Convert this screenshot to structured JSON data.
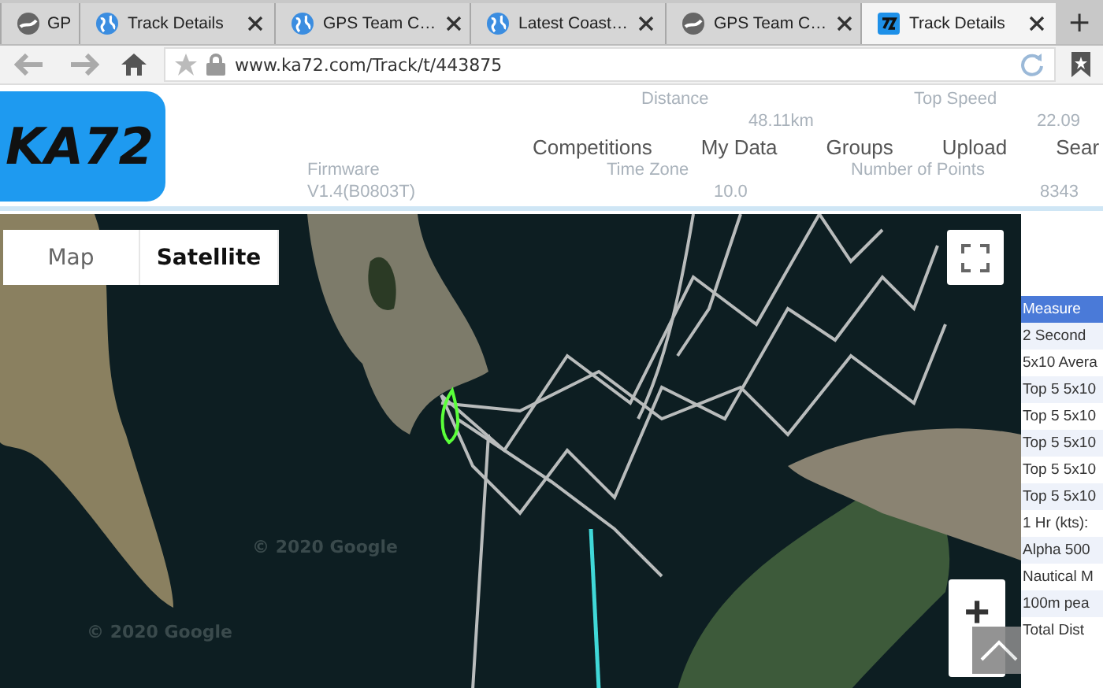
{
  "tabs": [
    {
      "label": "GP",
      "kind": "gray-logo",
      "selected": false,
      "close": false
    },
    {
      "label": "Track Details",
      "kind": "globe",
      "selected": false,
      "close": true
    },
    {
      "label": "GPS Team C…",
      "kind": "globe",
      "selected": false,
      "close": true
    },
    {
      "label": "Latest Coast…",
      "kind": "globe",
      "selected": false,
      "close": true
    },
    {
      "label": "GPS Team C…",
      "kind": "gray-logo",
      "selected": false,
      "close": true
    },
    {
      "label": "Track Details",
      "kind": "blue-logo",
      "selected": true,
      "close": true
    }
  ],
  "new_tab": "+",
  "address_bar": {
    "url": "www.ka72.com/Track/t/443875"
  },
  "site": {
    "logo": "KA72",
    "nav": [
      "Competitions",
      "My Data",
      "Groups",
      "Upload",
      "Sear"
    ],
    "stats": [
      {
        "label": "Distance",
        "value": "48.11km"
      },
      {
        "label": "Top Speed",
        "value": "22.09"
      },
      {
        "label": "Firmware",
        "value": "V1.4(B0803T)"
      },
      {
        "label": "Time Zone",
        "value": "10.0"
      },
      {
        "label": "Number of Points",
        "value": "8343"
      }
    ]
  },
  "map": {
    "types": [
      {
        "label": "Map",
        "selected": false
      },
      {
        "label": "Satellite",
        "selected": true
      }
    ],
    "attribution": [
      "© 2020 Google",
      "© 2020 Google"
    ],
    "zoom_in": "+"
  },
  "measures": {
    "header": "Measure",
    "rows": [
      "2 Second",
      "5x10 Avera",
      "Top 5 5x10",
      "Top 5 5x10",
      "Top 5 5x10",
      "Top 5 5x10",
      "Top 5 5x10",
      "1 Hr (kts):",
      "Alpha 500",
      "Nautical M",
      "100m pea",
      "Total Dist"
    ]
  }
}
